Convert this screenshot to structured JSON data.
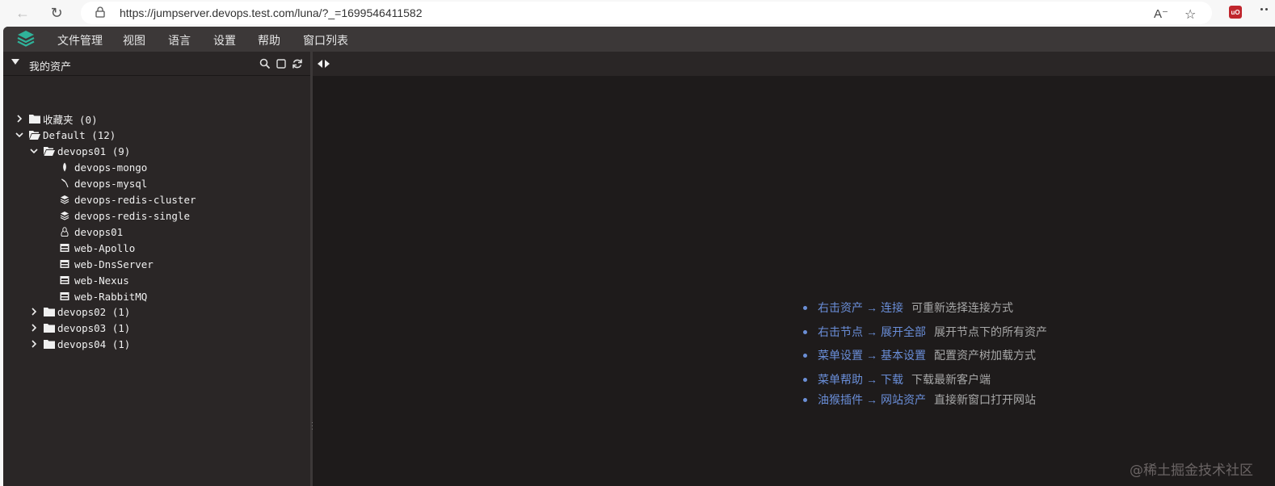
{
  "browser": {
    "url": "https://jumpserver.devops.test.com/luna/?_=1699546411582"
  },
  "menu": {
    "items": [
      "文件管理",
      "视图",
      "语言",
      "设置",
      "帮助",
      "窗口列表"
    ]
  },
  "sidebar": {
    "title": "我的资产",
    "tree": [
      {
        "label": "收藏夹 (0)",
        "kind": "folder",
        "expanded": false,
        "level": 0
      },
      {
        "label": "Default (12)",
        "kind": "folder-open",
        "expanded": true,
        "level": 0
      },
      {
        "label": "devops01 (9)",
        "kind": "folder-open",
        "expanded": true,
        "level": 1
      },
      {
        "label": "devops-mongo",
        "kind": "asset",
        "icon": "mongo-leaf-icon",
        "level": 2
      },
      {
        "label": "devops-mysql",
        "kind": "asset",
        "icon": "mysql-dolphin-icon",
        "level": 2
      },
      {
        "label": "devops-redis-cluster",
        "kind": "asset",
        "icon": "redis-layers-icon",
        "level": 2
      },
      {
        "label": "devops-redis-single",
        "kind": "asset",
        "icon": "redis-layers-icon",
        "level": 2
      },
      {
        "label": "devops01",
        "kind": "asset",
        "icon": "linux-tux-icon",
        "level": 2
      },
      {
        "label": "web-Apollo",
        "kind": "asset",
        "icon": "web-window-icon",
        "level": 2
      },
      {
        "label": "web-DnsServer",
        "kind": "asset",
        "icon": "web-window-icon",
        "level": 2
      },
      {
        "label": "web-Nexus",
        "kind": "asset",
        "icon": "web-window-icon",
        "level": 2
      },
      {
        "label": "web-RabbitMQ",
        "kind": "asset",
        "icon": "web-window-icon",
        "level": 2
      },
      {
        "label": "devops02 (1)",
        "kind": "folder",
        "expanded": false,
        "level": 1
      },
      {
        "label": "devops03 (1)",
        "kind": "folder",
        "expanded": false,
        "level": 1
      },
      {
        "label": "devops04 (1)",
        "kind": "folder",
        "expanded": false,
        "level": 1
      }
    ]
  },
  "tips": [
    {
      "action": "右击资产",
      "target": "连接",
      "desc": "可重新选择连接方式"
    },
    {
      "action": "右击节点",
      "target": "展开全部",
      "desc": "展开节点下的所有资产"
    },
    {
      "action": "菜单设置",
      "target": "基本设置",
      "desc": "配置资产树加载方式"
    },
    {
      "action": "菜单帮助",
      "target": "下载",
      "desc": "下载最新客户端"
    },
    {
      "action": "油猴插件",
      "target": "网站资产",
      "desc": "直接新窗口打开网站"
    }
  ],
  "arrow_glyph": "→",
  "watermark": "@稀土掘金技术社区",
  "colors": {
    "accent_link": "#6a8ed8",
    "menubar": "#3c3838",
    "panel": "#2a2626",
    "content": "#1e1b1b"
  }
}
